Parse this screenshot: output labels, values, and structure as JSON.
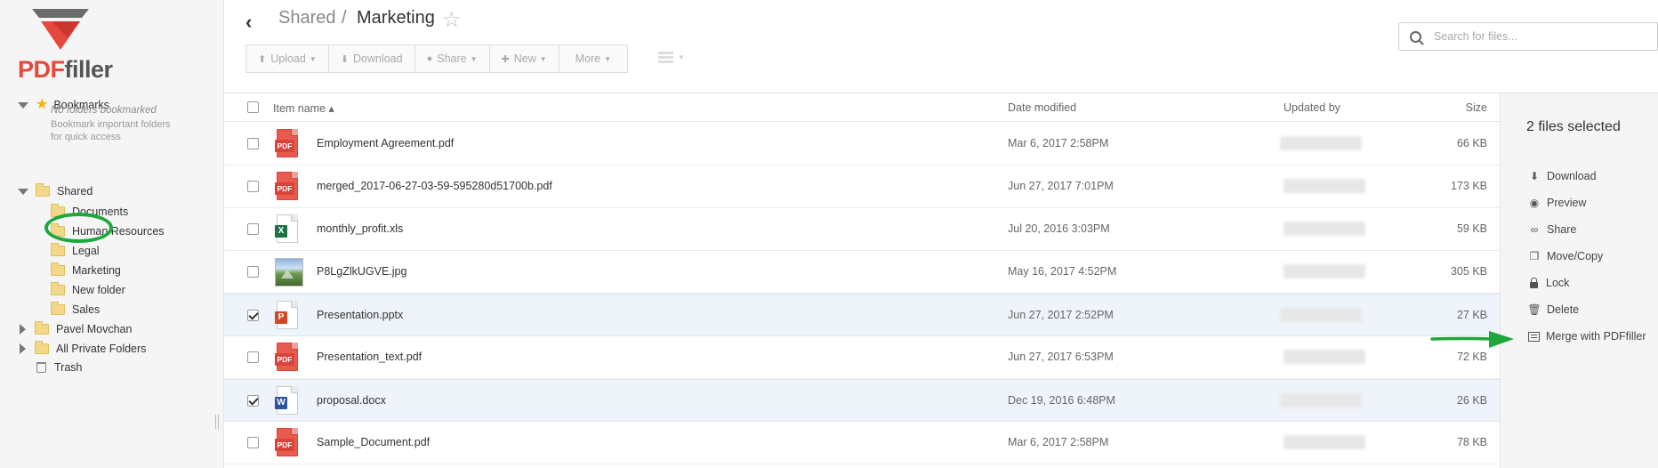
{
  "brand": {
    "logo_pdf": "PDF",
    "logo_filler": "filler"
  },
  "sidebar": {
    "bookmarks_label": "Bookmarks",
    "bookmarks_empty_title": "No folders bookmarked",
    "bookmarks_empty_hint": "Bookmark important folders for quick access",
    "shared_label": "Shared",
    "shared_children": [
      "Documents",
      "Human Resources",
      "Legal",
      "Marketing",
      "New folder",
      "Sales"
    ],
    "pavel_label": "Pavel Movchan",
    "private_label": "All Private Folders",
    "trash_label": "Trash",
    "highlight_color": "#1ea83c"
  },
  "header": {
    "breadcrumb_parent": "Shared",
    "breadcrumb_sep": "/",
    "breadcrumb_current": "Marketing",
    "search_placeholder": "Search for files..."
  },
  "toolbar": {
    "upload": "Upload",
    "download": "Download",
    "share": "Share",
    "new": "New",
    "more": "More"
  },
  "table": {
    "col_name": "Item name ▴",
    "col_date": "Date modified",
    "col_updated": "Updated by",
    "col_size": "Size",
    "rows": [
      {
        "name": "Employment Agreement.pdf",
        "type": "pdf",
        "date": "Mar 6, 2017 2:58PM",
        "size": "66 KB",
        "checked": false
      },
      {
        "name": "merged_2017-06-27-03-59-595280d51700b.pdf",
        "type": "pdf",
        "date": "Jun 27, 2017 7:01PM",
        "size": "173 KB",
        "checked": false
      },
      {
        "name": "monthly_profit.xls",
        "type": "xls",
        "date": "Jul 20, 2016 3:03PM",
        "size": "59 KB",
        "checked": false
      },
      {
        "name": "P8LgZlkUGVE.jpg",
        "type": "jpg",
        "date": "May 16, 2017 4:52PM",
        "size": "305 KB",
        "checked": false
      },
      {
        "name": "Presentation.pptx",
        "type": "ppt",
        "date": "Jun 27, 2017 2:52PM",
        "size": "27 KB",
        "checked": true
      },
      {
        "name": "Presentation_text.pdf",
        "type": "pdf",
        "date": "Jun 27, 2017 6:53PM",
        "size": "72 KB",
        "checked": false
      },
      {
        "name": "proposal.docx",
        "type": "doc",
        "date": "Dec 19, 2016 6:48PM",
        "size": "26 KB",
        "checked": true
      },
      {
        "name": "Sample_Document.pdf",
        "type": "pdf",
        "date": "Mar 6, 2017 2:58PM",
        "size": "78 KB",
        "checked": false
      }
    ]
  },
  "right_panel": {
    "selected_count": "2 files selected",
    "actions": [
      "Download",
      "Preview",
      "Share",
      "Move/Copy",
      "Lock",
      "Delete",
      "Merge with PDFfiller"
    ]
  },
  "annotation": {
    "arrow_color": "#1ea83c"
  }
}
